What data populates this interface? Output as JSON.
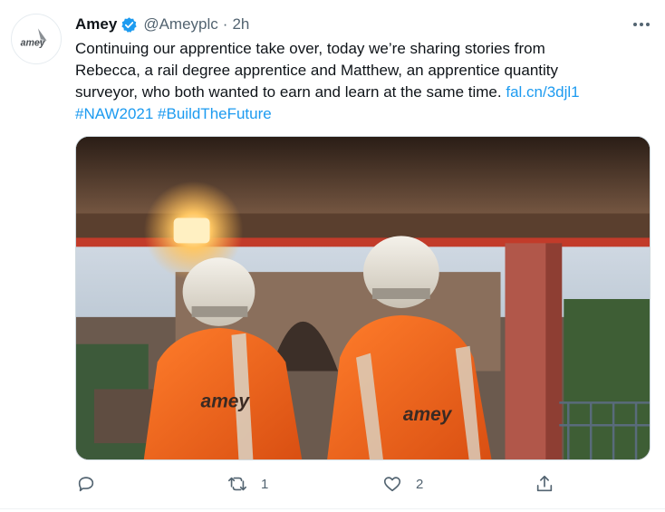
{
  "tweet": {
    "author_name": "Amey",
    "handle": "@Ameyplc",
    "separator": "·",
    "time": "2h",
    "avatar_logo_text": "amey",
    "text_line1": "Continuing our apprentice take over, today we’re sharing stories from",
    "text_line2": "Rebecca, a rail degree apprentice and Matthew, an apprentice quantity",
    "text_line3": "surveyor, who both wanted to earn and learn at the same time.",
    "link": "fal.cn/3djl1",
    "hashtag1": "#NAW2021",
    "hashtag2": "#BuildTheFuture",
    "image_logo_text": "amey"
  },
  "actions": {
    "reply_count": "",
    "retweet_count": "1",
    "like_count": "2"
  },
  "colors": {
    "link": "#1d9bf0",
    "verified": "#1d9bf0",
    "muted": "#536471",
    "hi_vis": "#f26a1b"
  },
  "icons": [
    "verified-badge-icon",
    "more-icon",
    "reply-icon",
    "retweet-icon",
    "like-icon",
    "share-icon"
  ]
}
